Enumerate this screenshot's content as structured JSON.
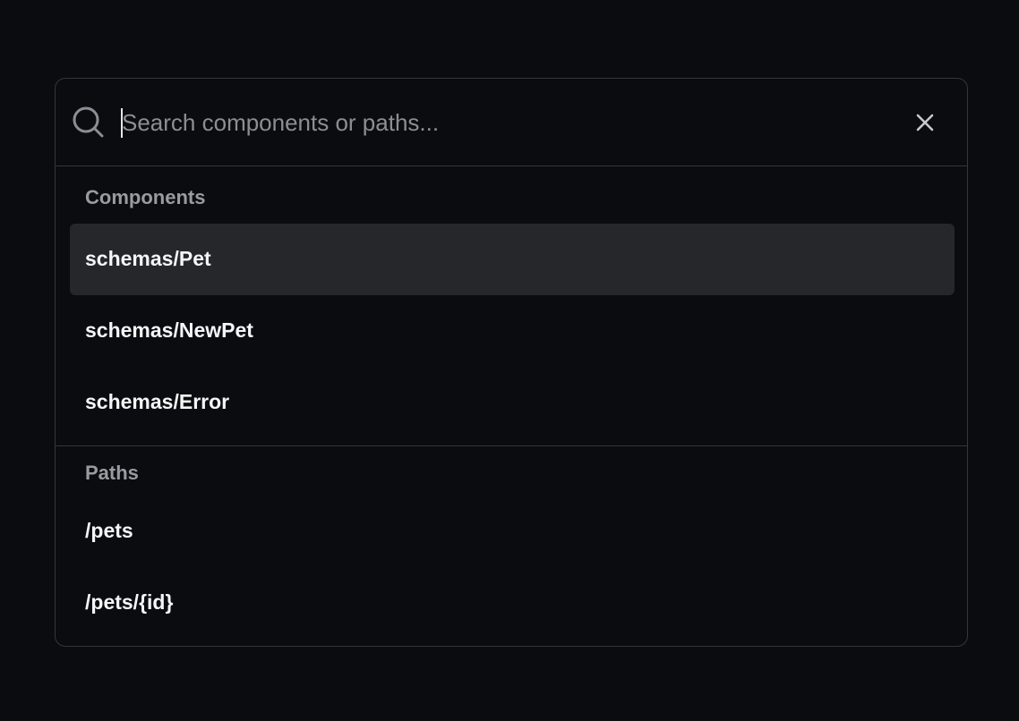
{
  "search": {
    "placeholder": "Search components or paths...",
    "value": ""
  },
  "icons": {
    "search": "search-icon",
    "clear": "close-icon"
  },
  "sections": [
    {
      "header": "Components",
      "items": [
        {
          "label": "schemas/Pet",
          "selected": true
        },
        {
          "label": "schemas/NewPet",
          "selected": false
        },
        {
          "label": "schemas/Error",
          "selected": false
        }
      ]
    },
    {
      "header": "Paths",
      "items": [
        {
          "label": "/pets",
          "selected": false
        },
        {
          "label": "/pets/{id}",
          "selected": false
        }
      ]
    }
  ],
  "colors": {
    "background": "#0b0c0f",
    "border": "#34363c",
    "selected_row": "#26272b",
    "text_primary": "#f5f5f7",
    "text_secondary": "#9a9ba2"
  }
}
